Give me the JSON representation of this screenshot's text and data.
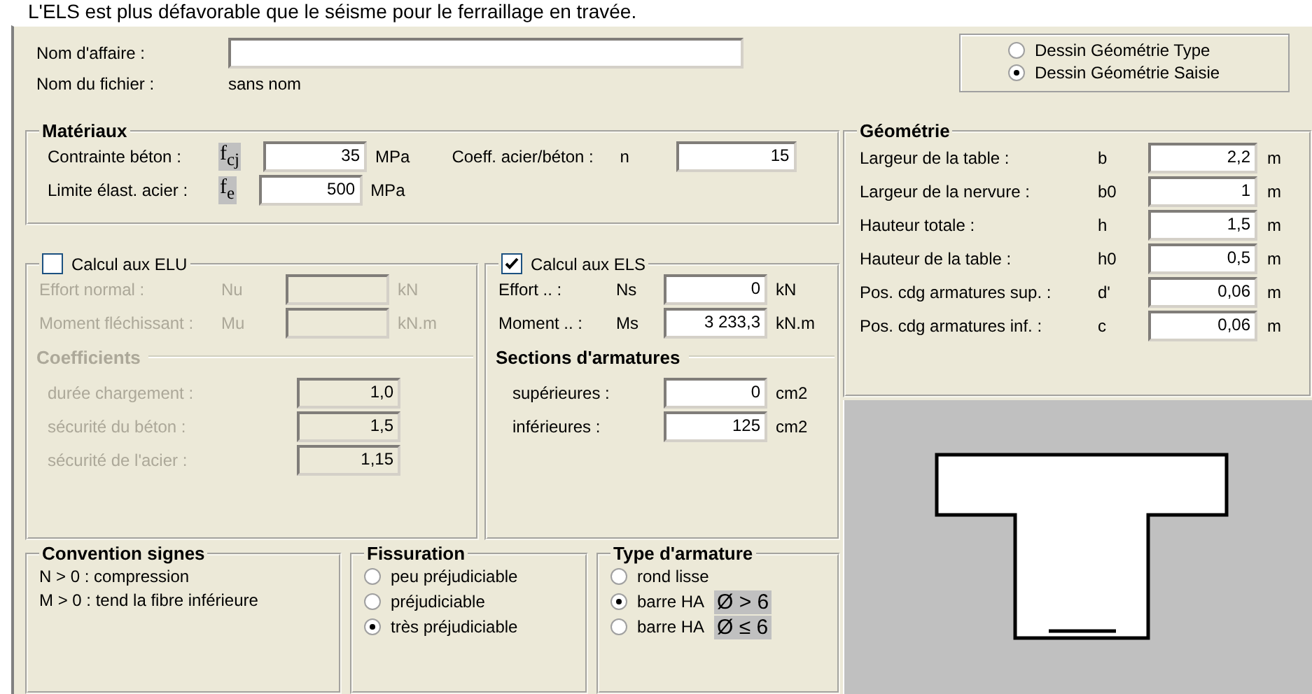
{
  "caption": "L'ELS est plus défavorable que le séisme pour le ferraillage en travée.",
  "project": {
    "label": "Nom d'affaire :"
  },
  "file": {
    "label": "Nom du fichier :",
    "value": "sans nom"
  },
  "drawing_mode": [
    {
      "label": "Dessin Géométrie Type",
      "selected": false
    },
    {
      "label": "Dessin Géométrie Saisie",
      "selected": true
    }
  ],
  "materials": {
    "title": "Matériaux",
    "rows": [
      {
        "label": "Contrainte béton :",
        "symbol": "f$_{cj}$",
        "value": "35",
        "unit": "MPa"
      },
      {
        "label": "Limite élast. acier :",
        "symbol": "f$_{e}$",
        "value": "500",
        "unit": "MPa"
      }
    ],
    "coeff": {
      "label": "Coeff. acier/béton :",
      "symbol": "n",
      "value": "15"
    }
  },
  "elu": {
    "title": "Calcul aux ELU",
    "checked": false,
    "rows": [
      {
        "label": "Effort normal :",
        "symbol": "Nu",
        "unit": "kN"
      },
      {
        "label": "Moment fléchissant :",
        "symbol": "Mu",
        "unit": "kN.m"
      }
    ],
    "coefficients": {
      "title": "Coefficients",
      "rows": [
        {
          "label": "durée chargement :",
          "value": "1,0"
        },
        {
          "label": "sécurité du béton :",
          "value": "1,5"
        },
        {
          "label": "sécurité de l'acier :",
          "value": "1,15"
        }
      ]
    }
  },
  "els": {
    "title": "Calcul aux ELS",
    "checked": true,
    "rows": [
      {
        "label": "Effort .. :",
        "symbol": "Ns",
        "value": "0",
        "unit": "kN"
      },
      {
        "label": "Moment .. :",
        "symbol": "Ms",
        "value": "3 233,3",
        "unit": "kN.m"
      }
    ],
    "sections": {
      "title": "Sections d'armatures",
      "rows": [
        {
          "label": "supérieures :",
          "value": "0",
          "unit": "cm2"
        },
        {
          "label": "inférieures :",
          "value": "125",
          "unit": "cm2"
        }
      ]
    }
  },
  "geometry": {
    "title": "Géométrie",
    "rows": [
      {
        "label": "Largeur de la table :",
        "symbol": "b",
        "value": "2,2",
        "unit": "m"
      },
      {
        "label": "Largeur de la nervure :",
        "symbol": "b0",
        "value": "1",
        "unit": "m"
      },
      {
        "label": "Hauteur totale :",
        "symbol": "h",
        "value": "1,5",
        "unit": "m"
      },
      {
        "label": "Hauteur de la table :",
        "symbol": "h0",
        "value": "0,5",
        "unit": "m"
      },
      {
        "label": "Pos. cdg armatures sup. :",
        "symbol": "d'",
        "value": "0,06",
        "unit": "m"
      },
      {
        "label": "Pos. cdg armatures inf. :",
        "symbol": "c",
        "value": "0,06",
        "unit": "m"
      }
    ]
  },
  "conventions": {
    "title": "Convention signes",
    "lines": [
      "N > 0 : compression",
      "M > 0 : tend la fibre inférieure"
    ]
  },
  "cracking": {
    "title": "Fissuration",
    "options": [
      {
        "label": "peu préjudiciable",
        "selected": false
      },
      {
        "label": "préjudiciable",
        "selected": false
      },
      {
        "label": "très préjudiciable",
        "selected": true
      }
    ]
  },
  "rebar_type": {
    "title": "Type d'armature",
    "options": [
      {
        "label": "rond lisse",
        "selected": false
      },
      {
        "label": "barre HA",
        "symbol": "Ø > 6",
        "selected": true
      },
      {
        "label": "barre HA",
        "symbol": "Ø ≤ 6",
        "selected": false
      }
    ]
  }
}
